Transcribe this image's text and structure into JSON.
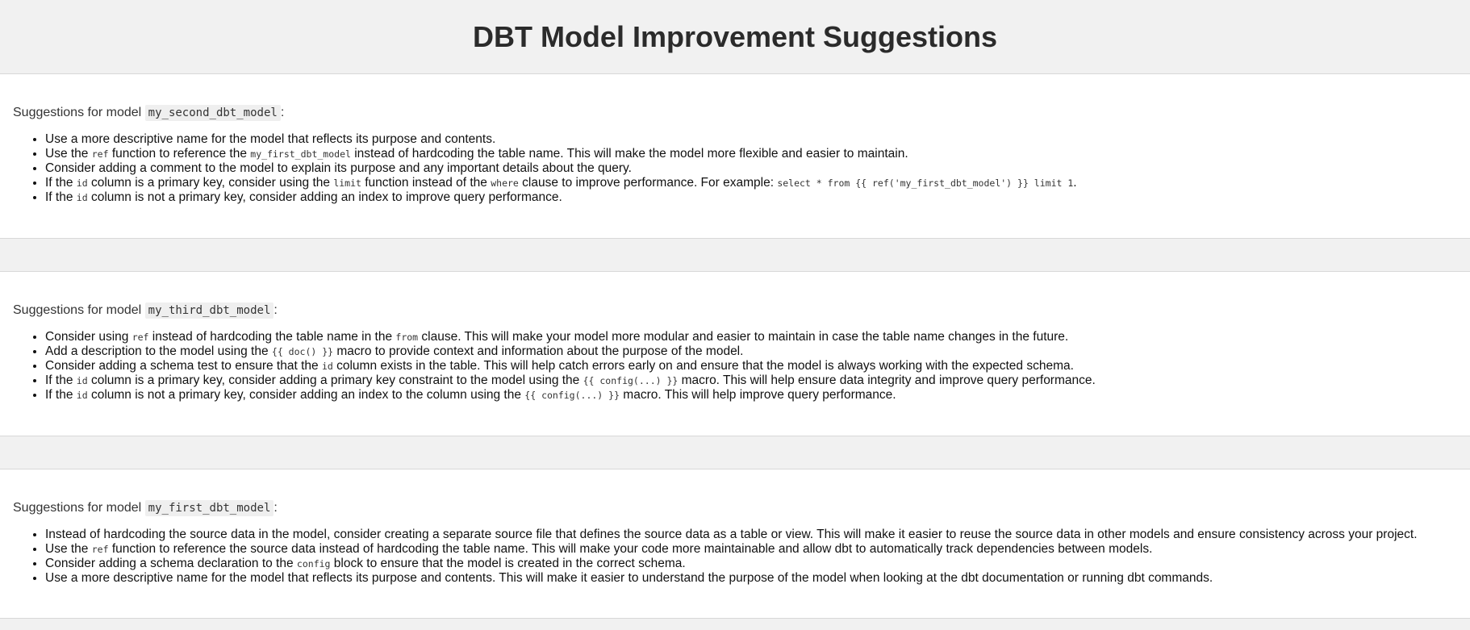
{
  "header": {
    "title": "DBT Model Improvement Suggestions"
  },
  "sections": [
    {
      "intro_prefix": "Suggestions for model ",
      "model_name": "my_second_dbt_model",
      "intro_suffix": ":",
      "items": [
        {
          "segments": [
            {
              "t": "text",
              "v": "Use a more descriptive name for the model that reflects its purpose and contents."
            }
          ]
        },
        {
          "segments": [
            {
              "t": "text",
              "v": "Use the "
            },
            {
              "t": "code",
              "v": "ref"
            },
            {
              "t": "text",
              "v": " function to reference the "
            },
            {
              "t": "code",
              "v": "my_first_dbt_model"
            },
            {
              "t": "text",
              "v": " instead of hardcoding the table name. This will make the model more flexible and easier to maintain."
            }
          ]
        },
        {
          "segments": [
            {
              "t": "text",
              "v": "Consider adding a comment to the model to explain its purpose and any important details about the query."
            }
          ]
        },
        {
          "segments": [
            {
              "t": "text",
              "v": "If the "
            },
            {
              "t": "code",
              "v": "id"
            },
            {
              "t": "text",
              "v": " column is a primary key, consider using the "
            },
            {
              "t": "code",
              "v": "limit"
            },
            {
              "t": "text",
              "v": " function instead of the "
            },
            {
              "t": "code",
              "v": "where"
            },
            {
              "t": "text",
              "v": " clause to improve performance. For example: "
            },
            {
              "t": "code",
              "v": "select * from {{ ref('my_first_dbt_model') }} limit 1"
            },
            {
              "t": "text",
              "v": "."
            }
          ]
        },
        {
          "segments": [
            {
              "t": "text",
              "v": "If the "
            },
            {
              "t": "code",
              "v": "id"
            },
            {
              "t": "text",
              "v": " column is not a primary key, consider adding an index to improve query performance."
            }
          ]
        }
      ]
    },
    {
      "intro_prefix": "Suggestions for model ",
      "model_name": "my_third_dbt_model",
      "intro_suffix": ":",
      "items": [
        {
          "segments": [
            {
              "t": "text",
              "v": "Consider using "
            },
            {
              "t": "code",
              "v": "ref"
            },
            {
              "t": "text",
              "v": " instead of hardcoding the table name in the "
            },
            {
              "t": "code",
              "v": "from"
            },
            {
              "t": "text",
              "v": " clause. This will make your model more modular and easier to maintain in case the table name changes in the future."
            }
          ]
        },
        {
          "segments": [
            {
              "t": "text",
              "v": "Add a description to the model using the "
            },
            {
              "t": "code",
              "v": "{{ doc() }}"
            },
            {
              "t": "text",
              "v": " macro to provide context and information about the purpose of the model."
            }
          ]
        },
        {
          "segments": [
            {
              "t": "text",
              "v": "Consider adding a schema test to ensure that the "
            },
            {
              "t": "code",
              "v": "id"
            },
            {
              "t": "text",
              "v": " column exists in the table. This will help catch errors early on and ensure that the model is always working with the expected schema."
            }
          ]
        },
        {
          "segments": [
            {
              "t": "text",
              "v": "If the "
            },
            {
              "t": "code",
              "v": "id"
            },
            {
              "t": "text",
              "v": " column is a primary key, consider adding a primary key constraint to the model using the "
            },
            {
              "t": "code",
              "v": "{{ config(...) }}"
            },
            {
              "t": "text",
              "v": " macro. This will help ensure data integrity and improve query performance."
            }
          ]
        },
        {
          "segments": [
            {
              "t": "text",
              "v": "If the "
            },
            {
              "t": "code",
              "v": "id"
            },
            {
              "t": "text",
              "v": " column is not a primary key, consider adding an index to the column using the "
            },
            {
              "t": "code",
              "v": "{{ config(...) }}"
            },
            {
              "t": "text",
              "v": " macro. This will help improve query performance."
            }
          ]
        }
      ]
    },
    {
      "intro_prefix": "Suggestions for model ",
      "model_name": "my_first_dbt_model",
      "intro_suffix": ":",
      "items": [
        {
          "segments": [
            {
              "t": "text",
              "v": "Instead of hardcoding the source data in the model, consider creating a separate source file that defines the source data as a table or view. This will make it easier to reuse the source data in other models and ensure consistency across your project."
            }
          ]
        },
        {
          "segments": [
            {
              "t": "text",
              "v": "Use the "
            },
            {
              "t": "code",
              "v": "ref"
            },
            {
              "t": "text",
              "v": " function to reference the source data instead of hardcoding the table name. This will make your code more maintainable and allow dbt to automatically track dependencies between models."
            }
          ]
        },
        {
          "segments": [
            {
              "t": "text",
              "v": "Consider adding a schema declaration to the "
            },
            {
              "t": "code",
              "v": "config"
            },
            {
              "t": "text",
              "v": " block to ensure that the model is created in the correct schema."
            }
          ]
        },
        {
          "segments": [
            {
              "t": "text",
              "v": "Use a more descriptive name for the model that reflects its purpose and contents. This will make it easier to understand the purpose of the model when looking at the dbt documentation or running dbt commands."
            }
          ]
        }
      ]
    }
  ]
}
